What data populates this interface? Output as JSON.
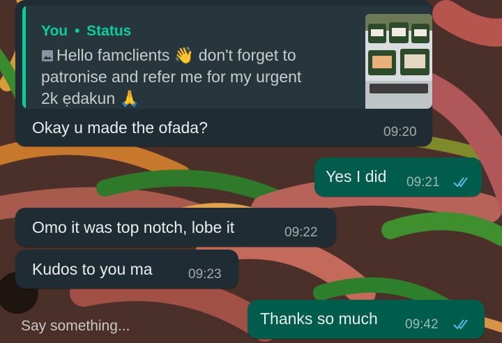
{
  "quoted": {
    "author": "You",
    "separator": "•",
    "source": "Status",
    "photo_icon": "image-icon",
    "line1": "Hello famclients 👋 don't forget to",
    "line2": "patronise and refer me for my urgent",
    "line3": "2k ẹdakun 🙏"
  },
  "messages": [
    {
      "text": "Okay u made the ofada?",
      "time": "09:20",
      "direction": "incoming"
    },
    {
      "text": "Yes I did",
      "time": "09:21",
      "direction": "outgoing",
      "status": "read"
    },
    {
      "text": "Omo it was top notch, lobe it",
      "time": "09:22",
      "direction": "incoming"
    },
    {
      "text": "Kudos to you ma",
      "time": "09:23",
      "direction": "incoming"
    },
    {
      "text": "Thanks so much",
      "time": "09:42",
      "direction": "outgoing",
      "status": "read"
    }
  ],
  "composer": {
    "placeholder": "Say something..."
  },
  "colors": {
    "incoming_bubble": "#1f2c33",
    "outgoing_bubble": "#005c4b",
    "accent": "#06cf9c",
    "read_ticks": "#53bdeb"
  }
}
